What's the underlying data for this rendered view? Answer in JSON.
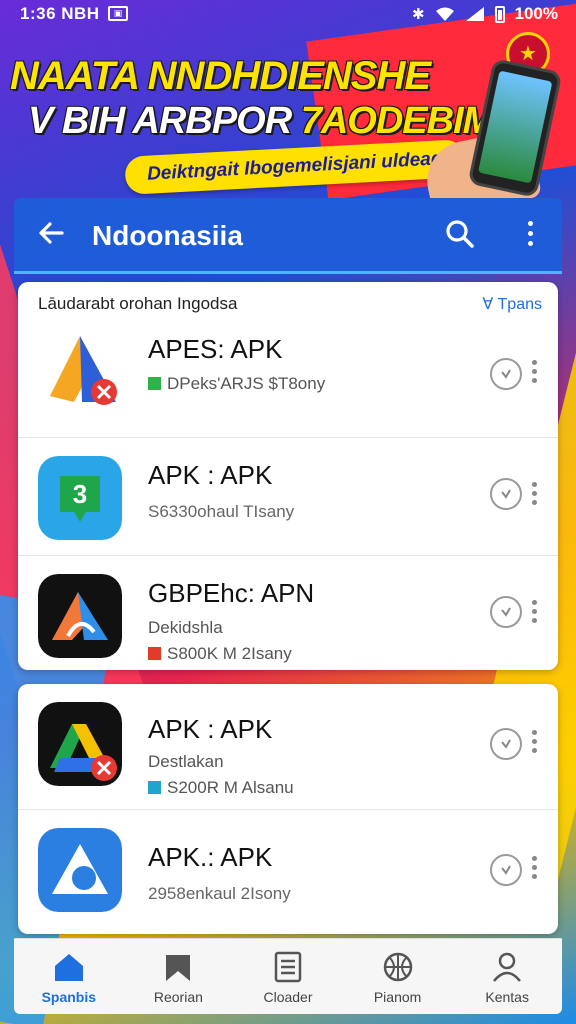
{
  "status_bar": {
    "time": "1:36 NBH",
    "notif_glyph": "▣",
    "battery": "100%"
  },
  "banner": {
    "line1": "NAATA NNDHDIENSHE",
    "line2_part1": "V BIH ARBPOR",
    "line2_part2": "7AODEBIM",
    "pill_text": "Deiktngait Ibogemelisjani uldeag"
  },
  "app_bar": {
    "title": "Ndoonasiia",
    "back_icon": "arrow-left",
    "search_icon": "search",
    "menu_icon": "more-vert"
  },
  "list": {
    "section_title": "Lāudarabt orohan Ingodsa",
    "section_link": "∀ Tpans",
    "card1_items": [
      {
        "name": "APES: APK",
        "sub1": "DPeks'ARJS $T8ony",
        "sub1_icon_color": "#2fb24a"
      },
      {
        "name": "APK : APK",
        "sub1": "S6330ohaul TIsany"
      },
      {
        "name": "GBPEhc: APN",
        "sub1": "Dekidshla",
        "sub2": "S800K M 2Isany",
        "sub2_icon_color": "#e33b2a"
      }
    ],
    "card2_items": [
      {
        "name": "APK : APK",
        "sub1": "Destlakan",
        "sub2": "S200R M Alsanu",
        "sub2_icon_color": "#1fa5c9"
      },
      {
        "name": "APK.: APK",
        "sub1": "2958enkaul 2Isony"
      }
    ]
  },
  "bottom_nav": [
    {
      "label": "Spanbis",
      "icon": "home-icon",
      "active": true
    },
    {
      "label": "Reorian",
      "icon": "bookmark-icon",
      "active": false
    },
    {
      "label": "Cloader",
      "icon": "document-icon",
      "active": false
    },
    {
      "label": "Pianom",
      "icon": "globe-icon",
      "active": false
    },
    {
      "label": "Kentas",
      "icon": "person-icon",
      "active": false
    }
  ],
  "colors": {
    "app_bar": "#1f5cd8",
    "accent": "#1f6fe0",
    "banner_yellow": "#ffe400"
  }
}
